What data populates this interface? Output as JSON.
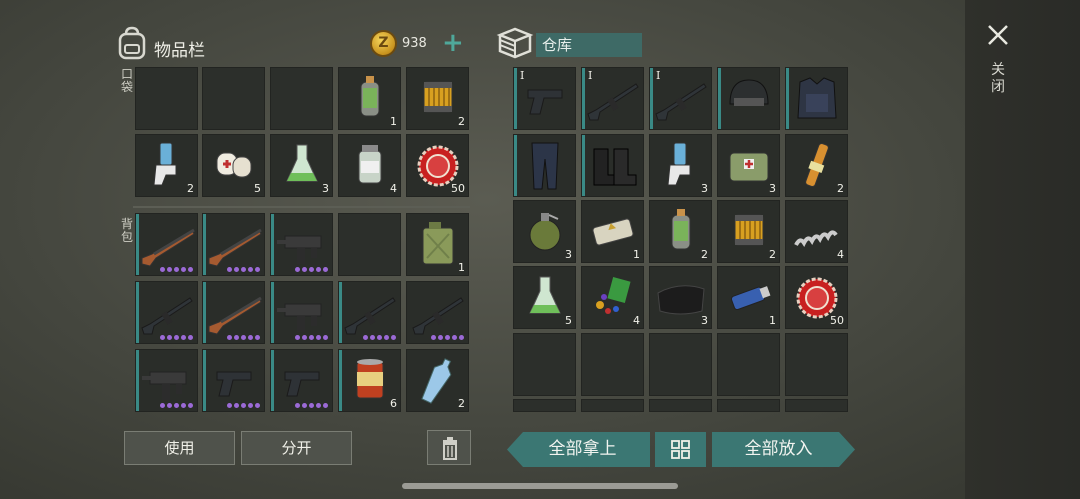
{
  "colors": {
    "accent": "#3a8a86",
    "teal_button": "#3b7773",
    "rarity_purple": "#9b6ad6",
    "coin_gold": "#e0b030"
  },
  "inventory": {
    "title": "物品栏",
    "coins": "938",
    "pocket_label": "口袋",
    "backpack_label": "背包",
    "pocket": [
      {
        "icon": "",
        "count": "",
        "tier": "",
        "dots": 0
      },
      {
        "icon": "",
        "count": "",
        "tier": "",
        "dots": 0
      },
      {
        "icon": "",
        "count": "",
        "tier": "",
        "dots": 0
      },
      {
        "icon": "gas-canister-icon",
        "count": "1",
        "tier": "",
        "dots": 0
      },
      {
        "icon": "filter-icon",
        "count": "2",
        "tier": "",
        "dots": 0
      },
      {
        "icon": "inhaler-icon",
        "count": "2",
        "tier": "",
        "dots": 0
      },
      {
        "icon": "bandage-icon",
        "count": "5",
        "tier": "",
        "dots": 0
      },
      {
        "icon": "flask-icon",
        "count": "3",
        "tier": "",
        "dots": 0
      },
      {
        "icon": "pill-bottle-icon",
        "count": "4",
        "tier": "",
        "dots": 0
      },
      {
        "icon": "bottle-cap-icon",
        "count": "50",
        "tier": "",
        "dots": 0
      }
    ],
    "backpack": [
      {
        "icon": "shotgun-icon",
        "count": "",
        "tier": "",
        "dots": 5
      },
      {
        "icon": "shotgun-icon",
        "count": "",
        "tier": "",
        "dots": 5
      },
      {
        "icon": "smg-icon",
        "count": "",
        "tier": "",
        "dots": 5
      },
      {
        "icon": "",
        "count": "",
        "tier": "",
        "dots": 0
      },
      {
        "icon": "jerrycan-icon",
        "count": "1",
        "tier": "",
        "dots": 0
      },
      {
        "icon": "rifle-icon",
        "count": "",
        "tier": "",
        "dots": 5
      },
      {
        "icon": "shotgun-icon",
        "count": "",
        "tier": "",
        "dots": 5
      },
      {
        "icon": "smg-icon",
        "count": "",
        "tier": "",
        "dots": 5
      },
      {
        "icon": "rifle-icon",
        "count": "",
        "tier": "",
        "dots": 5
      },
      {
        "icon": "rifle-icon",
        "count": "",
        "tier": "",
        "dots": 5
      },
      {
        "icon": "smg-icon",
        "count": "",
        "tier": "",
        "dots": 5
      },
      {
        "icon": "pistol-icon",
        "count": "",
        "tier": "",
        "dots": 5
      },
      {
        "icon": "pistol-icon",
        "count": "",
        "tier": "",
        "dots": 5
      },
      {
        "icon": "food-can-icon",
        "count": "6",
        "tier": "",
        "dots": 0
      },
      {
        "icon": "water-bottle-icon",
        "count": "2",
        "tier": "",
        "dots": 0
      }
    ],
    "use_label": "使用",
    "split_label": "分开"
  },
  "warehouse": {
    "name": "仓库",
    "items": [
      {
        "icon": "pistol-icon",
        "count": "",
        "tier": "I",
        "dots": 0
      },
      {
        "icon": "rifle-icon",
        "count": "",
        "tier": "I",
        "dots": 0
      },
      {
        "icon": "rifle-icon",
        "count": "",
        "tier": "I",
        "dots": 0
      },
      {
        "icon": "helmet-icon",
        "count": "",
        "tier": "",
        "dots": 0
      },
      {
        "icon": "armor-vest-icon",
        "count": "",
        "tier": "",
        "dots": 0
      },
      {
        "icon": "pants-icon",
        "count": "",
        "tier": "",
        "dots": 0
      },
      {
        "icon": "boots-icon",
        "count": "",
        "tier": "",
        "dots": 0
      },
      {
        "icon": "inhaler-icon",
        "count": "3",
        "tier": "",
        "dots": 0
      },
      {
        "icon": "medkit-bag-icon",
        "count": "3",
        "tier": "",
        "dots": 0
      },
      {
        "icon": "vial-icon",
        "count": "2",
        "tier": "",
        "dots": 0
      },
      {
        "icon": "grenade-icon",
        "count": "3",
        "tier": "",
        "dots": 0
      },
      {
        "icon": "c4-icon",
        "count": "1",
        "tier": "",
        "dots": 0
      },
      {
        "icon": "gas-canister-icon",
        "count": "2",
        "tier": "",
        "dots": 0
      },
      {
        "icon": "filter-icon",
        "count": "2",
        "tier": "",
        "dots": 0
      },
      {
        "icon": "spring-icon",
        "count": "4",
        "tier": "",
        "dots": 0
      },
      {
        "icon": "flask-icon",
        "count": "5",
        "tier": "",
        "dots": 0
      },
      {
        "icon": "parts-icon",
        "count": "4",
        "tier": "",
        "dots": 0
      },
      {
        "icon": "cloth-icon",
        "count": "3",
        "tier": "",
        "dots": 0
      },
      {
        "icon": "usb-drive-icon",
        "count": "1",
        "tier": "",
        "dots": 0
      },
      {
        "icon": "bottle-cap-icon",
        "count": "50",
        "tier": "",
        "dots": 0
      },
      {
        "icon": "",
        "count": "",
        "tier": "",
        "dots": 0
      },
      {
        "icon": "",
        "count": "",
        "tier": "",
        "dots": 0
      },
      {
        "icon": "",
        "count": "",
        "tier": "",
        "dots": 0
      },
      {
        "icon": "",
        "count": "",
        "tier": "",
        "dots": 0
      },
      {
        "icon": "",
        "count": "",
        "tier": "",
        "dots": 0
      },
      {
        "icon": "",
        "count": "",
        "tier": "",
        "dots": 0
      },
      {
        "icon": "",
        "count": "",
        "tier": "",
        "dots": 0
      },
      {
        "icon": "",
        "count": "",
        "tier": "",
        "dots": 0
      },
      {
        "icon": "",
        "count": "",
        "tier": "",
        "dots": 0
      },
      {
        "icon": "",
        "count": "",
        "tier": "",
        "dots": 0
      }
    ],
    "take_all_label": "全部拿上",
    "put_all_label": "全部放入"
  },
  "close_label": "关闭"
}
